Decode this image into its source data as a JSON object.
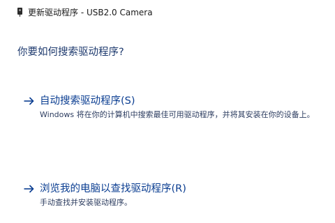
{
  "window": {
    "title": "更新驱动程序 - USB2.0 Camera",
    "icon": "camera-device-icon"
  },
  "heading": "你要如何搜索驱动程序?",
  "options": [
    {
      "label": "自动搜索驱动程序(S)",
      "description": "Windows 将在你的计算机中搜索最佳可用驱动程序，并将其安装在你的设备上。",
      "icon": "arrow-right-icon"
    },
    {
      "label": "浏览我的电脑以查找驱动程序(R)",
      "description": "手动查找并安装驱动程序。",
      "icon": "arrow-right-icon"
    }
  ],
  "colors": {
    "link": "#0a3d91",
    "heading": "#1e3a6e",
    "description": "#2d3d60",
    "title": "#1a1a1a"
  }
}
